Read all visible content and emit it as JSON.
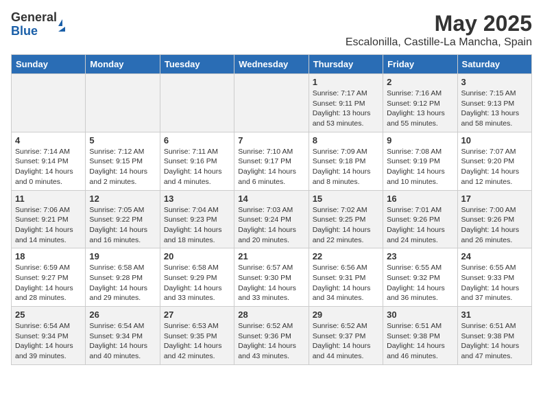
{
  "logo": {
    "general": "General",
    "blue": "Blue"
  },
  "title": "May 2025",
  "subtitle": "Escalonilla, Castille-La Mancha, Spain",
  "headers": [
    "Sunday",
    "Monday",
    "Tuesday",
    "Wednesday",
    "Thursday",
    "Friday",
    "Saturday"
  ],
  "weeks": [
    [
      {
        "day": "",
        "info": ""
      },
      {
        "day": "",
        "info": ""
      },
      {
        "day": "",
        "info": ""
      },
      {
        "day": "",
        "info": ""
      },
      {
        "day": "1",
        "info": "Sunrise: 7:17 AM\nSunset: 9:11 PM\nDaylight: 13 hours\nand 53 minutes."
      },
      {
        "day": "2",
        "info": "Sunrise: 7:16 AM\nSunset: 9:12 PM\nDaylight: 13 hours\nand 55 minutes."
      },
      {
        "day": "3",
        "info": "Sunrise: 7:15 AM\nSunset: 9:13 PM\nDaylight: 13 hours\nand 58 minutes."
      }
    ],
    [
      {
        "day": "4",
        "info": "Sunrise: 7:14 AM\nSunset: 9:14 PM\nDaylight: 14 hours\nand 0 minutes."
      },
      {
        "day": "5",
        "info": "Sunrise: 7:12 AM\nSunset: 9:15 PM\nDaylight: 14 hours\nand 2 minutes."
      },
      {
        "day": "6",
        "info": "Sunrise: 7:11 AM\nSunset: 9:16 PM\nDaylight: 14 hours\nand 4 minutes."
      },
      {
        "day": "7",
        "info": "Sunrise: 7:10 AM\nSunset: 9:17 PM\nDaylight: 14 hours\nand 6 minutes."
      },
      {
        "day": "8",
        "info": "Sunrise: 7:09 AM\nSunset: 9:18 PM\nDaylight: 14 hours\nand 8 minutes."
      },
      {
        "day": "9",
        "info": "Sunrise: 7:08 AM\nSunset: 9:19 PM\nDaylight: 14 hours\nand 10 minutes."
      },
      {
        "day": "10",
        "info": "Sunrise: 7:07 AM\nSunset: 9:20 PM\nDaylight: 14 hours\nand 12 minutes."
      }
    ],
    [
      {
        "day": "11",
        "info": "Sunrise: 7:06 AM\nSunset: 9:21 PM\nDaylight: 14 hours\nand 14 minutes."
      },
      {
        "day": "12",
        "info": "Sunrise: 7:05 AM\nSunset: 9:22 PM\nDaylight: 14 hours\nand 16 minutes."
      },
      {
        "day": "13",
        "info": "Sunrise: 7:04 AM\nSunset: 9:23 PM\nDaylight: 14 hours\nand 18 minutes."
      },
      {
        "day": "14",
        "info": "Sunrise: 7:03 AM\nSunset: 9:24 PM\nDaylight: 14 hours\nand 20 minutes."
      },
      {
        "day": "15",
        "info": "Sunrise: 7:02 AM\nSunset: 9:25 PM\nDaylight: 14 hours\nand 22 minutes."
      },
      {
        "day": "16",
        "info": "Sunrise: 7:01 AM\nSunset: 9:26 PM\nDaylight: 14 hours\nand 24 minutes."
      },
      {
        "day": "17",
        "info": "Sunrise: 7:00 AM\nSunset: 9:26 PM\nDaylight: 14 hours\nand 26 minutes."
      }
    ],
    [
      {
        "day": "18",
        "info": "Sunrise: 6:59 AM\nSunset: 9:27 PM\nDaylight: 14 hours\nand 28 minutes."
      },
      {
        "day": "19",
        "info": "Sunrise: 6:58 AM\nSunset: 9:28 PM\nDaylight: 14 hours\nand 29 minutes."
      },
      {
        "day": "20",
        "info": "Sunrise: 6:58 AM\nSunset: 9:29 PM\nDaylight: 14 hours\nand 33 minutes."
      },
      {
        "day": "21",
        "info": "Sunrise: 6:57 AM\nSunset: 9:30 PM\nDaylight: 14 hours\nand 33 minutes."
      },
      {
        "day": "22",
        "info": "Sunrise: 6:56 AM\nSunset: 9:31 PM\nDaylight: 14 hours\nand 34 minutes."
      },
      {
        "day": "23",
        "info": "Sunrise: 6:55 AM\nSunset: 9:32 PM\nDaylight: 14 hours\nand 36 minutes."
      },
      {
        "day": "24",
        "info": "Sunrise: 6:55 AM\nSunset: 9:33 PM\nDaylight: 14 hours\nand 37 minutes."
      }
    ],
    [
      {
        "day": "25",
        "info": "Sunrise: 6:54 AM\nSunset: 9:34 PM\nDaylight: 14 hours\nand 39 minutes."
      },
      {
        "day": "26",
        "info": "Sunrise: 6:54 AM\nSunset: 9:34 PM\nDaylight: 14 hours\nand 40 minutes."
      },
      {
        "day": "27",
        "info": "Sunrise: 6:53 AM\nSunset: 9:35 PM\nDaylight: 14 hours\nand 42 minutes."
      },
      {
        "day": "28",
        "info": "Sunrise: 6:52 AM\nSunset: 9:36 PM\nDaylight: 14 hours\nand 43 minutes."
      },
      {
        "day": "29",
        "info": "Sunrise: 6:52 AM\nSunset: 9:37 PM\nDaylight: 14 hours\nand 44 minutes."
      },
      {
        "day": "30",
        "info": "Sunrise: 6:51 AM\nSunset: 9:38 PM\nDaylight: 14 hours\nand 46 minutes."
      },
      {
        "day": "31",
        "info": "Sunrise: 6:51 AM\nSunset: 9:38 PM\nDaylight: 14 hours\nand 47 minutes."
      }
    ]
  ]
}
